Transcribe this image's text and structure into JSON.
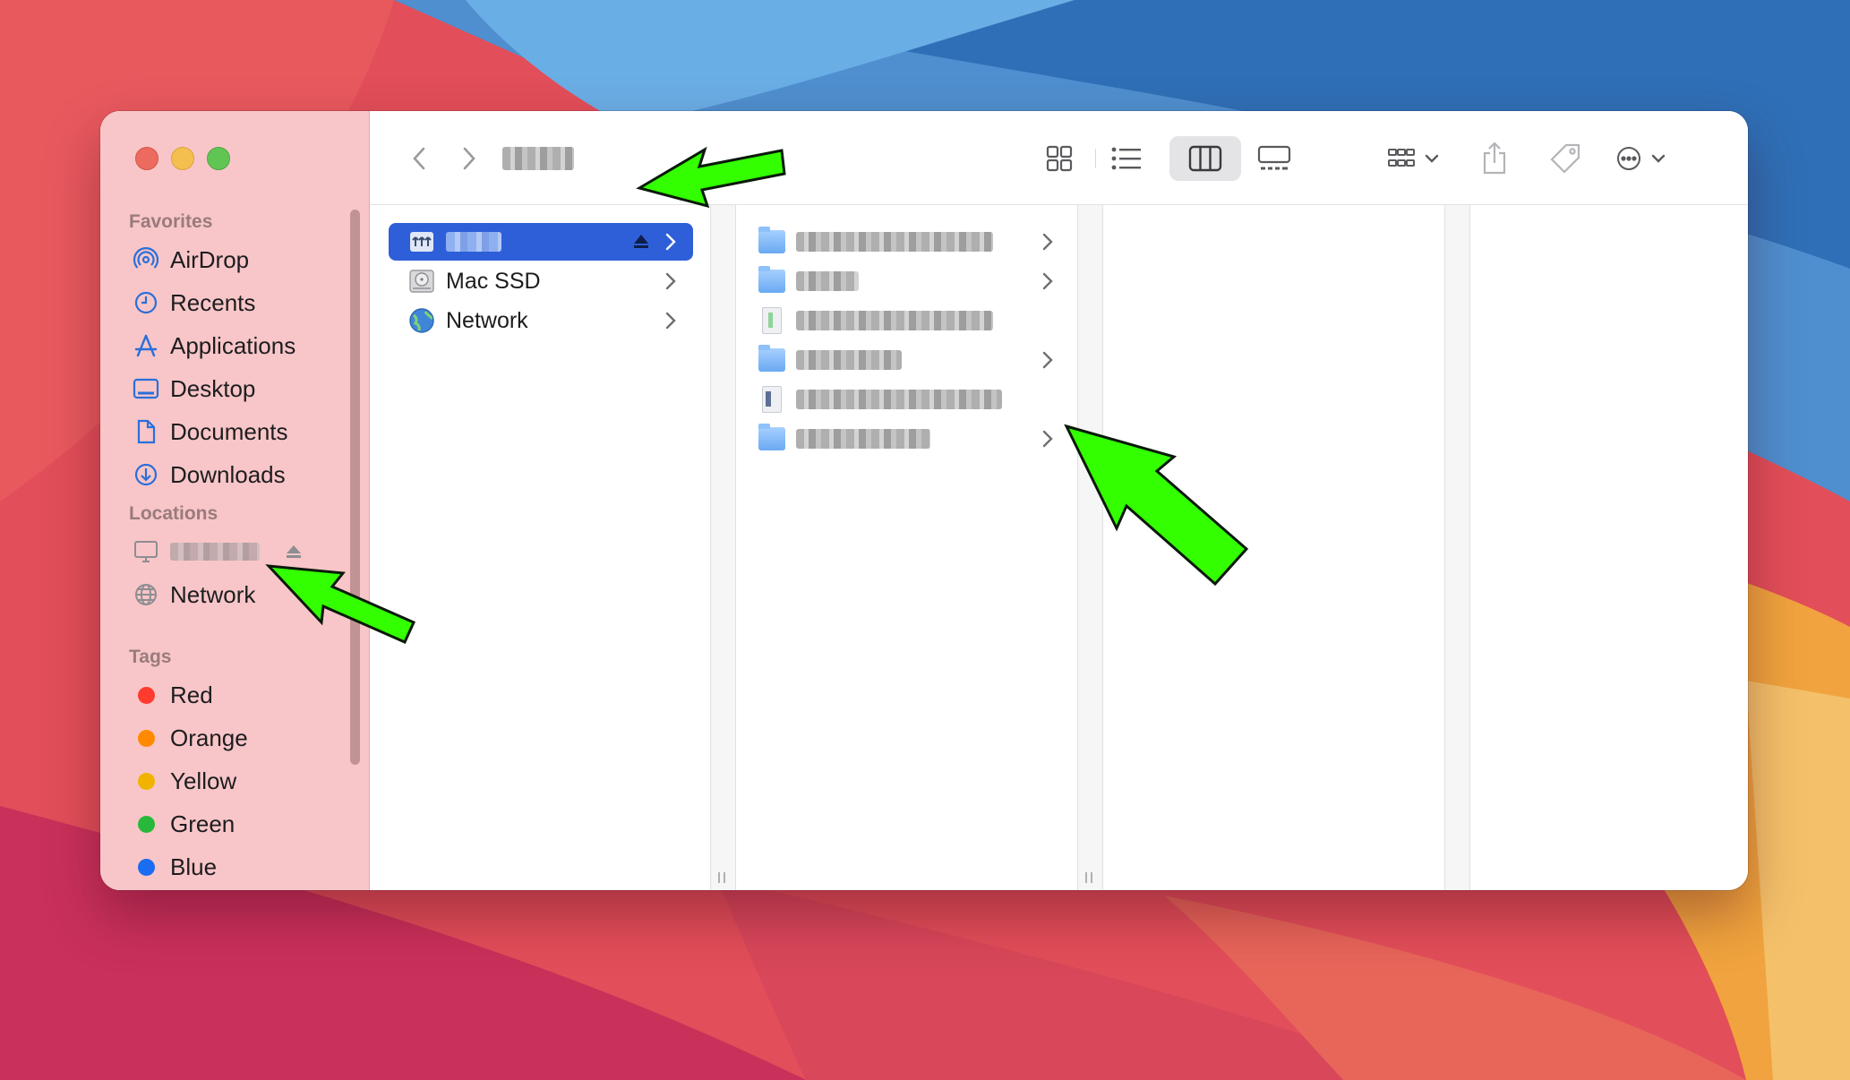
{
  "colors": {
    "accent": "#2f5fd8",
    "annotation_arrow": "#33ff00",
    "tag_red": "#ff3b30",
    "tag_orange": "#ff8a00",
    "tag_yellow": "#f0b400",
    "tag_green": "#28b83b",
    "tag_blue": "#1a6cf0"
  },
  "sidebar": {
    "favorites_heading": "Favorites",
    "favorites": [
      {
        "label": "AirDrop",
        "icon": "airdrop-icon"
      },
      {
        "label": "Recents",
        "icon": "clock-icon"
      },
      {
        "label": "Applications",
        "icon": "applications-icon"
      },
      {
        "label": "Desktop",
        "icon": "desktop-icon"
      },
      {
        "label": "Documents",
        "icon": "document-icon"
      },
      {
        "label": "Downloads",
        "icon": "download-icon"
      }
    ],
    "locations_heading": "Locations",
    "locations": [
      {
        "label": "",
        "icon": "computer-icon",
        "redacted": true,
        "eject": true
      },
      {
        "label": "Network",
        "icon": "globe-icon"
      }
    ],
    "tags_heading": "Tags",
    "tags": [
      {
        "label": "Red",
        "color": "#ff3b30"
      },
      {
        "label": "Orange",
        "color": "#ff8a00"
      },
      {
        "label": "Yellow",
        "color": "#f0b400"
      },
      {
        "label": "Green",
        "color": "#28b83b"
      },
      {
        "label": "Blue",
        "color": "#1a6cf0"
      }
    ]
  },
  "toolbar": {
    "window_title": "",
    "title_redacted": true,
    "view_modes": [
      "icon-view-icon",
      "list-view-icon",
      "column-view-icon",
      "gallery-view-icon"
    ],
    "active_view": "column-view-icon"
  },
  "columns": {
    "first": [
      {
        "label": "",
        "icon": "server-volume-icon",
        "redacted": true,
        "selected": true,
        "eject": true
      },
      {
        "label": "Mac SSD",
        "icon": "hard-disk-icon"
      },
      {
        "label": "Network",
        "icon": "network-globe-icon"
      }
    ],
    "second": [
      {
        "type": "folder",
        "has_children": true
      },
      {
        "type": "folder",
        "has_children": true
      },
      {
        "type": "file",
        "has_children": false
      },
      {
        "type": "folder",
        "has_children": true
      },
      {
        "type": "file",
        "has_children": false
      },
      {
        "type": "folder",
        "has_children": true
      }
    ]
  }
}
